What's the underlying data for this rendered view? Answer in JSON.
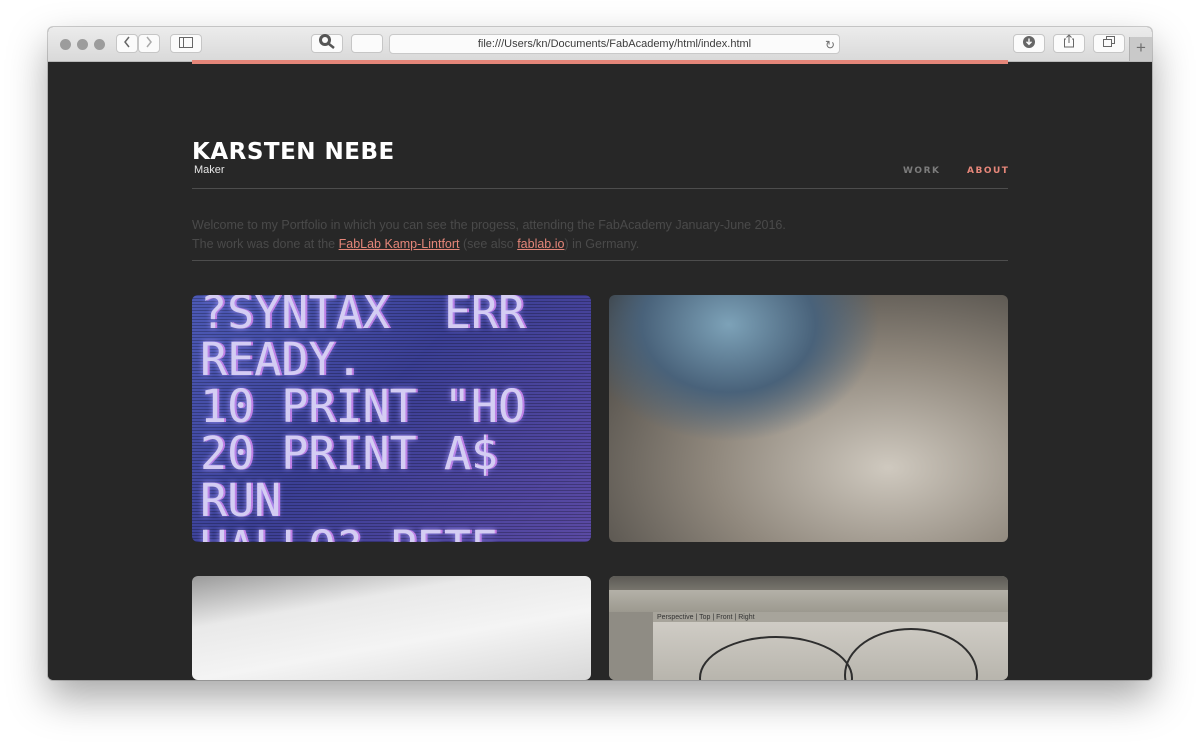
{
  "browser": {
    "url": "file:///Users/kn/Documents/FabAcademy/html/index.html",
    "new_tab_glyph": "+"
  },
  "site": {
    "title": "KARSTEN NEBE",
    "subtitle": "Maker",
    "nav": {
      "work": "WORK",
      "about": "ABOUT"
    },
    "accent_color": "#e58679"
  },
  "intro": {
    "line1": "Welcome to my Portfolio in which you can see the progess, attending the FabAcademy January-June 2016.",
    "line2_prefix": "The work was done at the ",
    "link1": "FabLab Kamp-Lintfort",
    "line2_middle": " (see also ",
    "link2": "fablab.io",
    "line2_suffix": ") in Germany."
  },
  "tiles": {
    "screen_text": "?SYNTAX  ERR\nREADY.\n10 PRINT \"HO\n20 PRINT A$\nRUN\nHALLO? PETE",
    "cad_tabs": "Perspective   |   Top   |   Front   |   Right"
  }
}
